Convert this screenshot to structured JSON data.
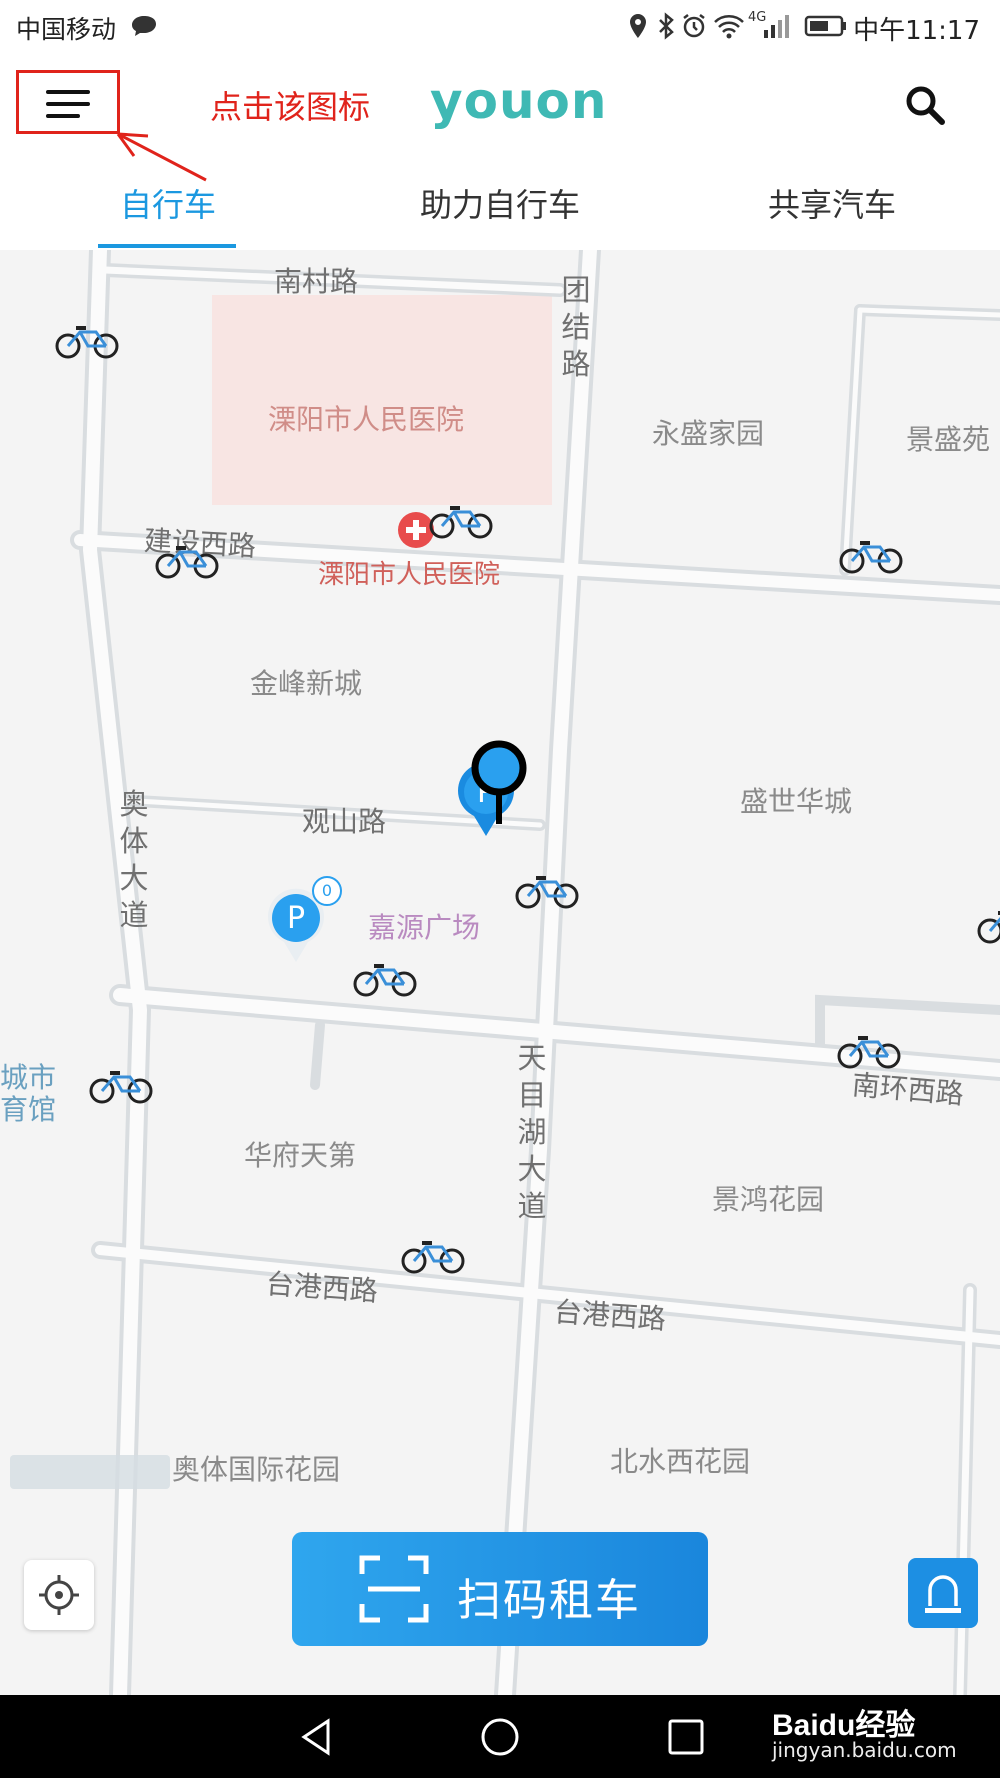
{
  "status_bar": {
    "carrier": "中国移动",
    "network": "4G",
    "time": "中午11:17"
  },
  "header": {
    "annotation_hint": "点击该图标",
    "logo_text": "youon",
    "brand_color": "#3fb9b4",
    "hint_color": "#e0231b"
  },
  "tabs": [
    {
      "label": "自行车",
      "active": true
    },
    {
      "label": "助力自行车",
      "active": false
    },
    {
      "label": "共享汽车",
      "active": false
    }
  ],
  "accent_color": "#1b98e0",
  "map": {
    "places": [
      "溧阳市人民医院",
      "永盛家园",
      "景盛苑",
      "金峰新城",
      "盛世华城",
      "嘉源广场",
      "华府天第",
      "景鸿花园",
      "奥体国际花园",
      "北水西花园",
      "城市",
      "育馆"
    ],
    "roads": [
      "南村路",
      "团结路",
      "建设西路",
      "观山路",
      "奥体大道",
      "天目湖大道",
      "南环西路",
      "台港西路",
      "台港西路"
    ],
    "poi_labels": [
      "溧阳市人民医院"
    ],
    "parking_count": "0"
  },
  "controls": {
    "scan_button": "扫码租车",
    "locate_icon": "crosshair-icon",
    "alarm_icon": "siren-icon"
  },
  "watermark": {
    "brand": "Baidu经验",
    "url": "jingyan.baidu.com"
  }
}
